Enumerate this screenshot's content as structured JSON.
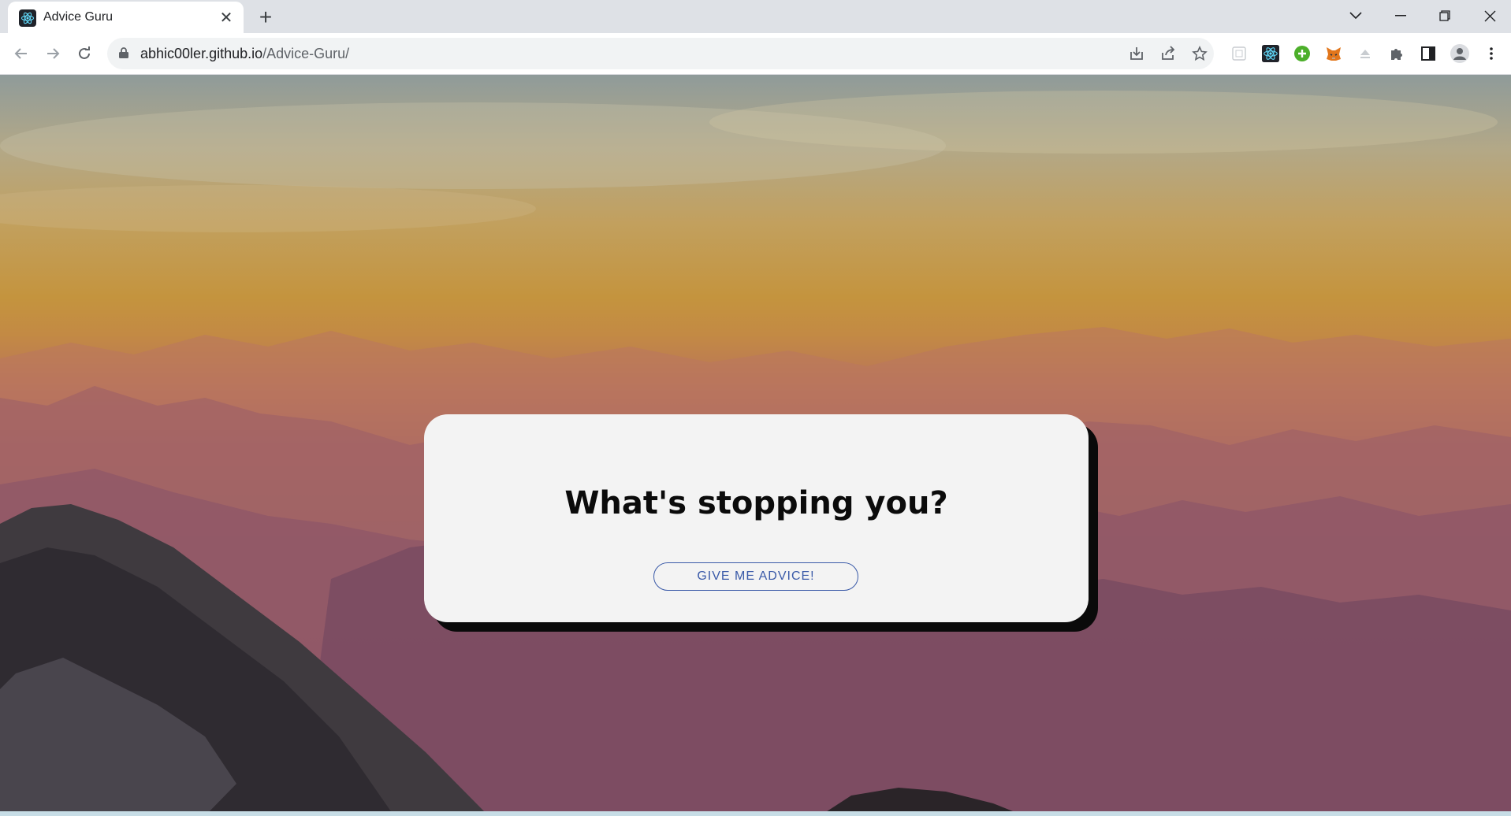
{
  "browser": {
    "tab": {
      "title": "Advice Guru",
      "favicon": "react-icon"
    },
    "new_tab_icon": "plus-icon",
    "window_controls": [
      "tab-search-icon",
      "minimize-icon",
      "restore-icon",
      "close-icon"
    ],
    "nav": [
      "back-icon",
      "forward-icon",
      "reload-icon"
    ],
    "address": {
      "host": "abhic00ler.github.io",
      "path": "/Advice-Guru/"
    },
    "toolbar_icons": [
      "install-icon",
      "share-icon",
      "bookmark-star-icon",
      "extension-placeholder-icon",
      "react-devtools-icon",
      "green-plus-extension-icon",
      "metamask-fox-icon",
      "eject-icon",
      "extensions-puzzle-icon",
      "side-panel-icon",
      "profile-avatar-icon",
      "more-menu-icon"
    ]
  },
  "page": {
    "heading": "What's stopping you?",
    "button_label": "GIVE ME ADVICE!"
  },
  "colors": {
    "card_background": "#f3f3f3",
    "card_shadow": "#0a0a0a",
    "button_accent": "#3a5aa8"
  }
}
